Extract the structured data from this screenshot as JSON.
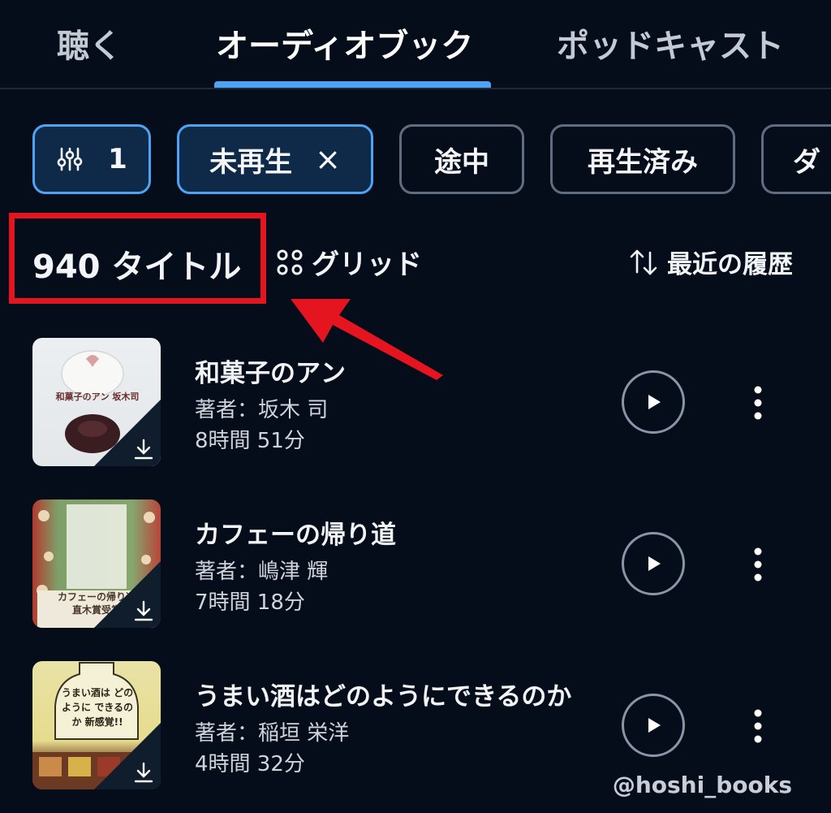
{
  "tabs": [
    {
      "label": "聴く"
    },
    {
      "label": "オーディオブック"
    },
    {
      "label": "ポッドキャスト"
    }
  ],
  "filters": {
    "filter_count": "1",
    "chips": [
      {
        "label": "未再生",
        "selected": true,
        "remove_icon": "×"
      },
      {
        "label": "途中"
      },
      {
        "label": "再生済み"
      },
      {
        "label": "ダ"
      }
    ]
  },
  "results": {
    "count_label": "940 タイトル",
    "view_label": "グリッド",
    "sort_label": "最近の履歴"
  },
  "books": [
    {
      "title": "和菓子のアン",
      "author": "著者：坂木 司",
      "length": "8時間 51分",
      "cover_text": "和菓子のアン 坂木司"
    },
    {
      "title": "カフェーの帰り道",
      "author": "著者：嶋津 輝",
      "length": "7時間 18分",
      "cover_text": "カフェーの帰り道 直木賞受賞"
    },
    {
      "title": "うまい酒はどのようにできるのか",
      "author": "著者：稲垣 栄洋",
      "length": "4時間 32分",
      "cover_text": "うまい酒は どのように できるのか 新感覚!!"
    }
  ],
  "watermark": "@hoshi_books",
  "colors": {
    "accent": "#4ea3f2",
    "highlight": "#e5151f",
    "background": "#050d1b"
  }
}
